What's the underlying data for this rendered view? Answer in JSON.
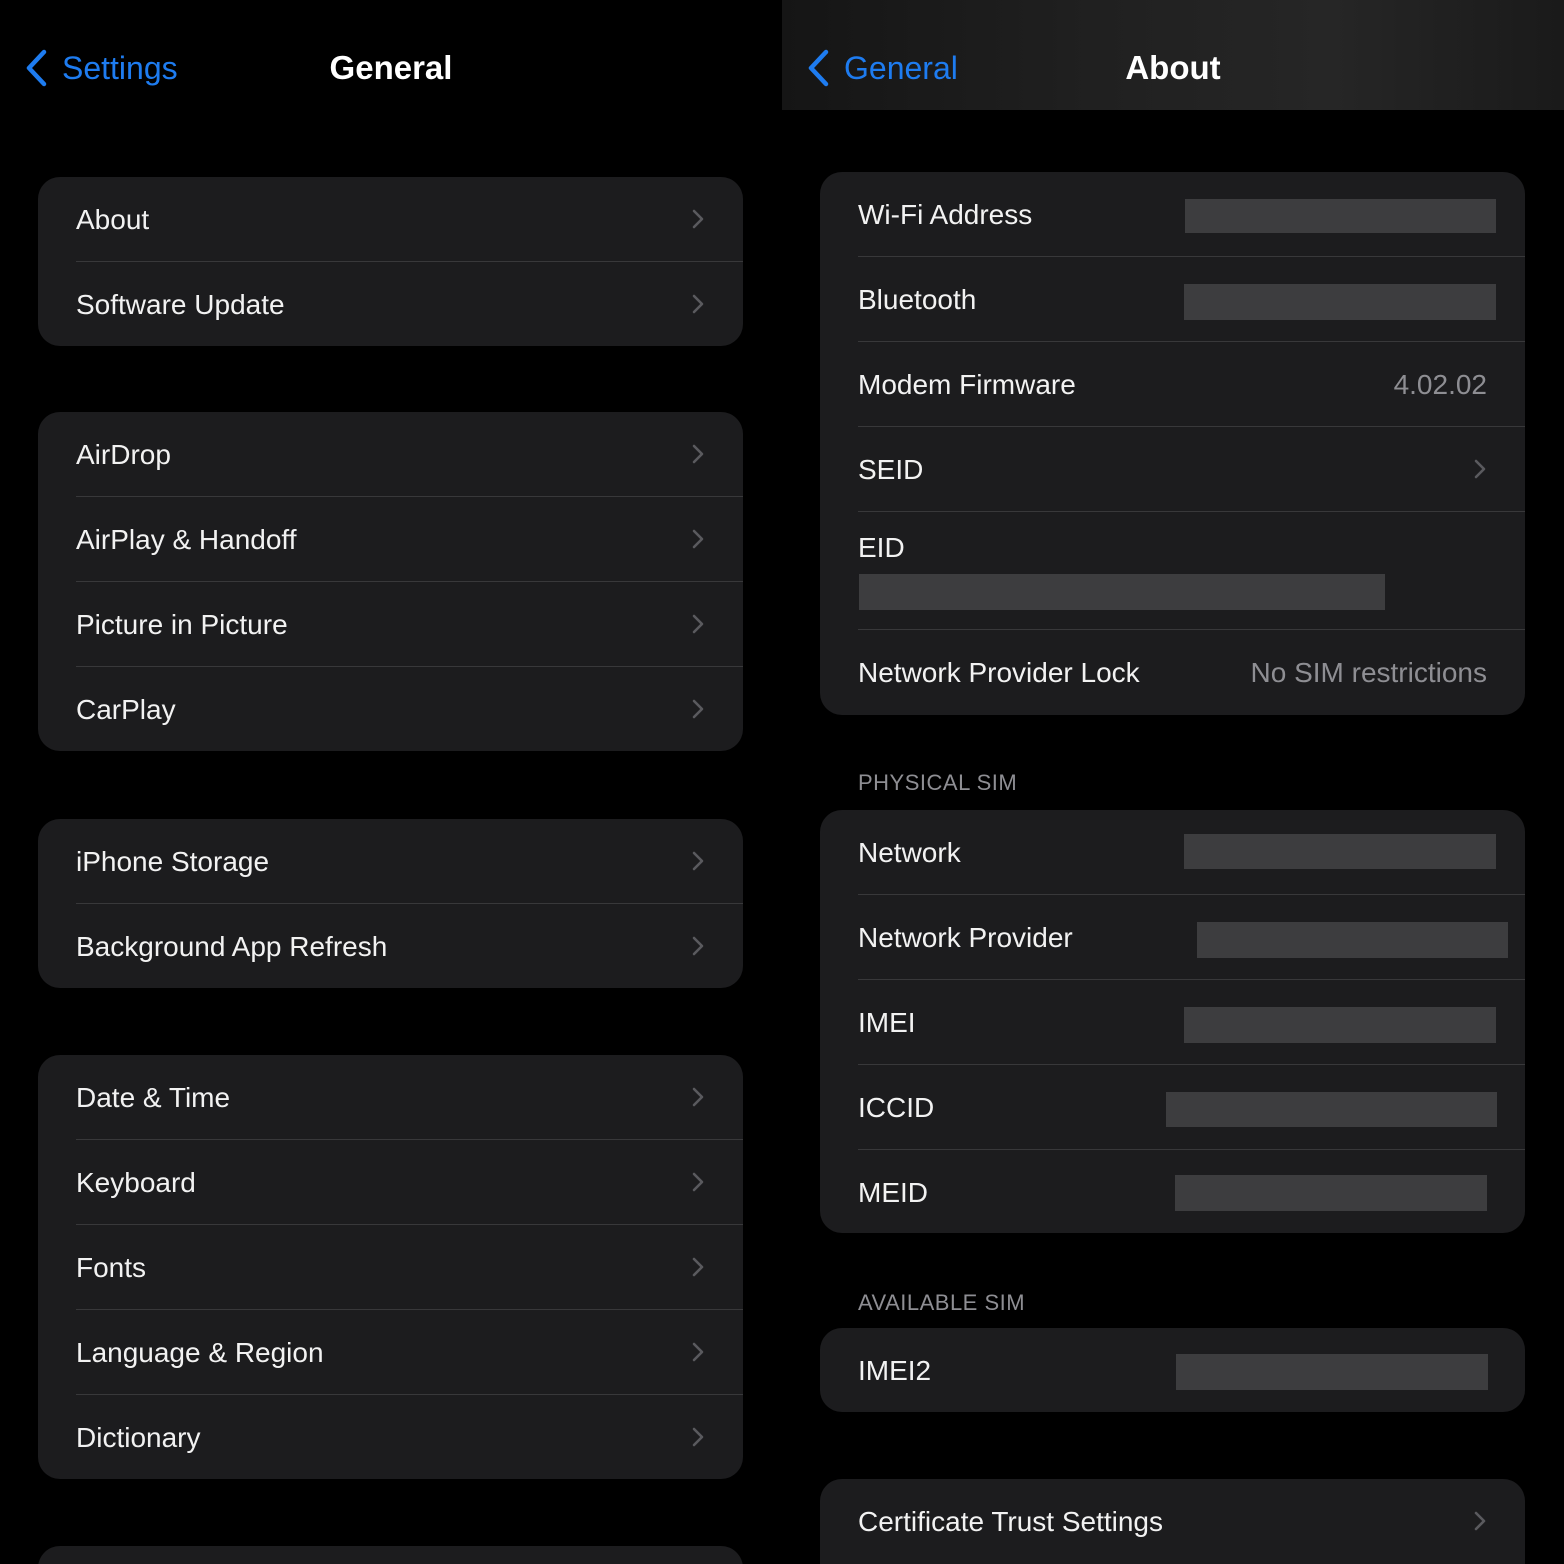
{
  "left_screen": {
    "back_label": "Settings",
    "title": "General",
    "groups": [
      {
        "rows": [
          {
            "label": "About"
          },
          {
            "label": "Software Update"
          }
        ]
      },
      {
        "rows": [
          {
            "label": "AirDrop"
          },
          {
            "label": "AirPlay & Handoff"
          },
          {
            "label": "Picture in Picture"
          },
          {
            "label": "CarPlay"
          }
        ]
      },
      {
        "rows": [
          {
            "label": "iPhone Storage"
          },
          {
            "label": "Background App Refresh"
          }
        ]
      },
      {
        "rows": [
          {
            "label": "Date & Time"
          },
          {
            "label": "Keyboard"
          },
          {
            "label": "Fonts"
          },
          {
            "label": "Language & Region"
          },
          {
            "label": "Dictionary"
          }
        ]
      }
    ]
  },
  "right_screen": {
    "back_label": "General",
    "title": "About",
    "info_rows": {
      "wifi_address": "Wi-Fi Address",
      "bluetooth": "Bluetooth",
      "modem_firmware": "Modem Firmware",
      "modem_firmware_value": "4.02.02",
      "seid": "SEID",
      "eid": "EID",
      "network_provider_lock": "Network Provider Lock",
      "network_provider_lock_value": "No SIM restrictions"
    },
    "physical_sim_header": "PHYSICAL SIM",
    "physical_sim_rows": {
      "network": "Network",
      "network_provider": "Network Provider",
      "imei": "IMEI",
      "iccid": "ICCID",
      "meid": "MEID"
    },
    "available_sim_header": "AVAILABLE SIM",
    "available_sim_rows": {
      "imei2": "IMEI2"
    },
    "certificate_trust_settings": "Certificate Trust Settings"
  },
  "colors": {
    "accent": "#1e7cf0",
    "background": "#000000",
    "cell_background": "#1c1c1e",
    "separator": "#38383a",
    "secondary_text": "#8e8e93",
    "redaction": "#3d3d3f"
  },
  "icons": {
    "back": "chevron-left-icon",
    "disclosure": "chevron-right-icon"
  }
}
